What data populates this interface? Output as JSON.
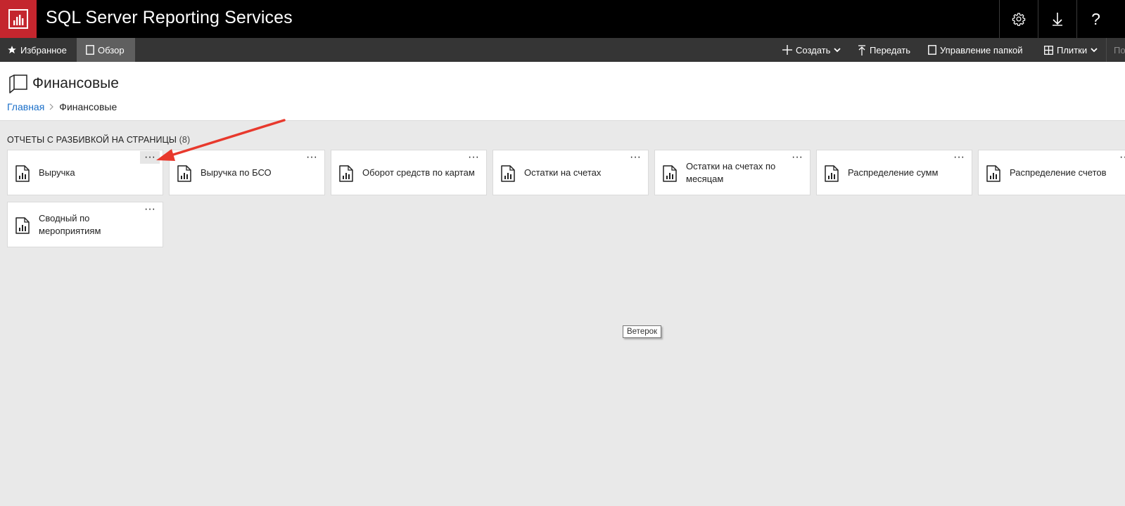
{
  "app": {
    "title": "SQL Server Reporting Services",
    "logo_icon": "ssrs-report-logo-icon",
    "logo_color": "#c4262e"
  },
  "topbar": {
    "settings_icon": "gear-icon",
    "download_icon": "download-icon",
    "help_label": "?"
  },
  "nav": {
    "favorites_label": "Избранное",
    "browse_label": "Обзор",
    "create_label": "Создать",
    "upload_label": "Передать",
    "manage_folder_label": "Управление папкой",
    "view_label": "Плитки",
    "search_placeholder": "По"
  },
  "folder": {
    "title": "Финансовые",
    "breadcrumb": {
      "home": "Главная",
      "current": "Финансовые"
    }
  },
  "section": {
    "title": "ОТЧЕТЫ С РАЗБИВКОЙ НА СТРАНИЦЫ",
    "count": "(8)"
  },
  "reports": [
    {
      "label": "Выручка"
    },
    {
      "label": "Выручка по БСО"
    },
    {
      "label": "Оборот средств по картам"
    },
    {
      "label": "Остатки на счетах"
    },
    {
      "label": "Остатки на счетах по месяцам"
    },
    {
      "label": "Распределение сумм"
    },
    {
      "label": "Распределение счетов"
    },
    {
      "label": "Сводный по мероприятиям"
    }
  ],
  "tile_menu_glyph": "···",
  "tooltip": {
    "text": "Ветерок"
  },
  "annotation": {
    "color": "#e8392d"
  }
}
